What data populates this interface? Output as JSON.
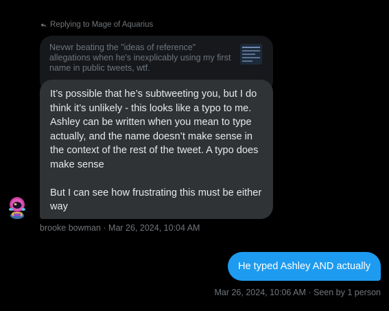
{
  "reply_header": {
    "icon": "reply-arrow-icon",
    "text": "Replying to Mage of Aquarius"
  },
  "quoted_message": {
    "text": "Nevwr beating the \"ideas of reference\" allegations when he's inexplicably using my first name in public tweets, wtf.",
    "thumbnail": "tweet-screenshot-thumbnail"
  },
  "incoming_message": {
    "text": "It’s possible that he’s subtweeting you, but I do think it’s unlikely - this looks like a typo to me. Ashley can be written when you mean to type actually, and the name doesn’t make sense in the context of the rest of the tweet. A typo does make sense\n\nBut I can see how frustrating this must be either way",
    "sender": "brooke bowman",
    "timestamp": "Mar 26, 2024, 10:04 AM",
    "meta": "brooke bowman · Mar 26, 2024, 10:04 AM",
    "avatar_icon": "astronaut-avatar-icon"
  },
  "outgoing_message": {
    "text": "He typed Ashley AND actually",
    "timestamp": "Mar 26, 2024, 10:06 AM",
    "seen": "Seen by 1 person",
    "meta": "Mar 26, 2024, 10:06 AM · Seen by 1 person"
  },
  "colors": {
    "background": "#000000",
    "incoming_bubble": "#2f3336",
    "quoted_bubble": "#16181c",
    "outgoing_bubble": "#1d9bf0",
    "secondary_text": "#71767b"
  }
}
